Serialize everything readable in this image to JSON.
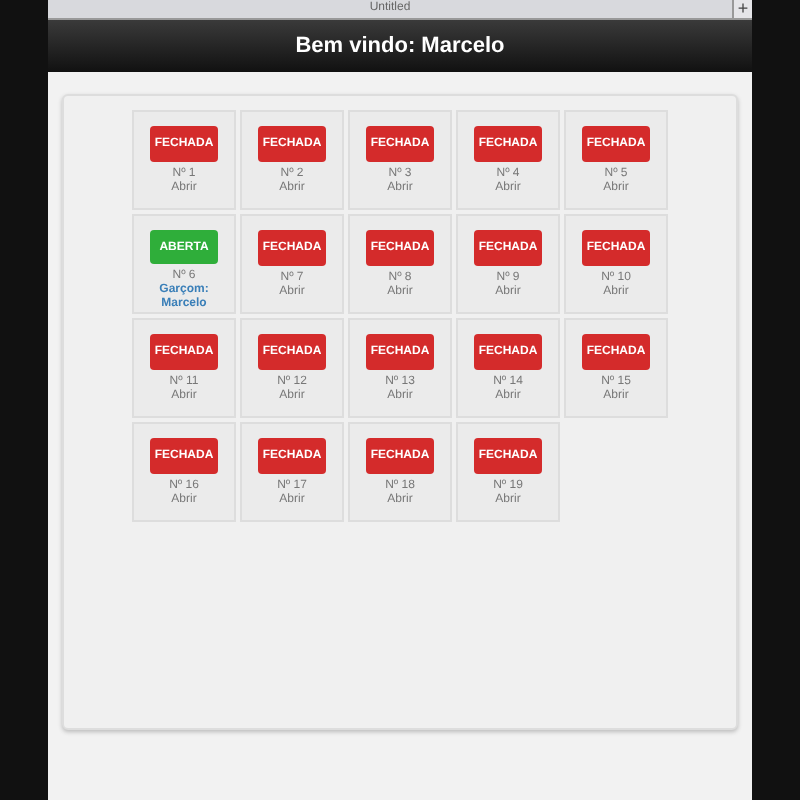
{
  "browser_tab": {
    "title": "Untitled",
    "new_tab": "+"
  },
  "header": {
    "title": "Bem vindo: Marcelo"
  },
  "tables": [
    {
      "kind": "closed",
      "badge": "FECHADA",
      "number": "Nº 1",
      "action": "Abrir"
    },
    {
      "kind": "closed",
      "badge": "FECHADA",
      "number": "Nº 2",
      "action": "Abrir"
    },
    {
      "kind": "closed",
      "badge": "FECHADA",
      "number": "Nº 3",
      "action": "Abrir"
    },
    {
      "kind": "closed",
      "badge": "FECHADA",
      "number": "Nº 4",
      "action": "Abrir"
    },
    {
      "kind": "closed",
      "badge": "FECHADA",
      "number": "Nº 5",
      "action": "Abrir"
    },
    {
      "kind": "open",
      "badge": "ABERTA",
      "number": "Nº 6",
      "action": "Garçom: Marcelo"
    },
    {
      "kind": "closed",
      "badge": "FECHADA",
      "number": "Nº 7",
      "action": "Abrir"
    },
    {
      "kind": "closed",
      "badge": "FECHADA",
      "number": "Nº 8",
      "action": "Abrir"
    },
    {
      "kind": "closed",
      "badge": "FECHADA",
      "number": "Nº 9",
      "action": "Abrir"
    },
    {
      "kind": "closed",
      "badge": "FECHADA",
      "number": "Nº 10",
      "action": "Abrir"
    },
    {
      "kind": "closed",
      "badge": "FECHADA",
      "number": "Nº 11",
      "action": "Abrir"
    },
    {
      "kind": "closed",
      "badge": "FECHADA",
      "number": "Nº 12",
      "action": "Abrir"
    },
    {
      "kind": "closed",
      "badge": "FECHADA",
      "number": "Nº 13",
      "action": "Abrir"
    },
    {
      "kind": "closed",
      "badge": "FECHADA",
      "number": "Nº 14",
      "action": "Abrir"
    },
    {
      "kind": "closed",
      "badge": "FECHADA",
      "number": "Nº 15",
      "action": "Abrir"
    },
    {
      "kind": "closed",
      "badge": "FECHADA",
      "number": "Nº 16",
      "action": "Abrir"
    },
    {
      "kind": "closed",
      "badge": "FECHADA",
      "number": "Nº 17",
      "action": "Abrir"
    },
    {
      "kind": "closed",
      "badge": "FECHADA",
      "number": "Nº 18",
      "action": "Abrir"
    },
    {
      "kind": "closed",
      "badge": "FECHADA",
      "number": "Nº 19",
      "action": "Abrir"
    }
  ]
}
